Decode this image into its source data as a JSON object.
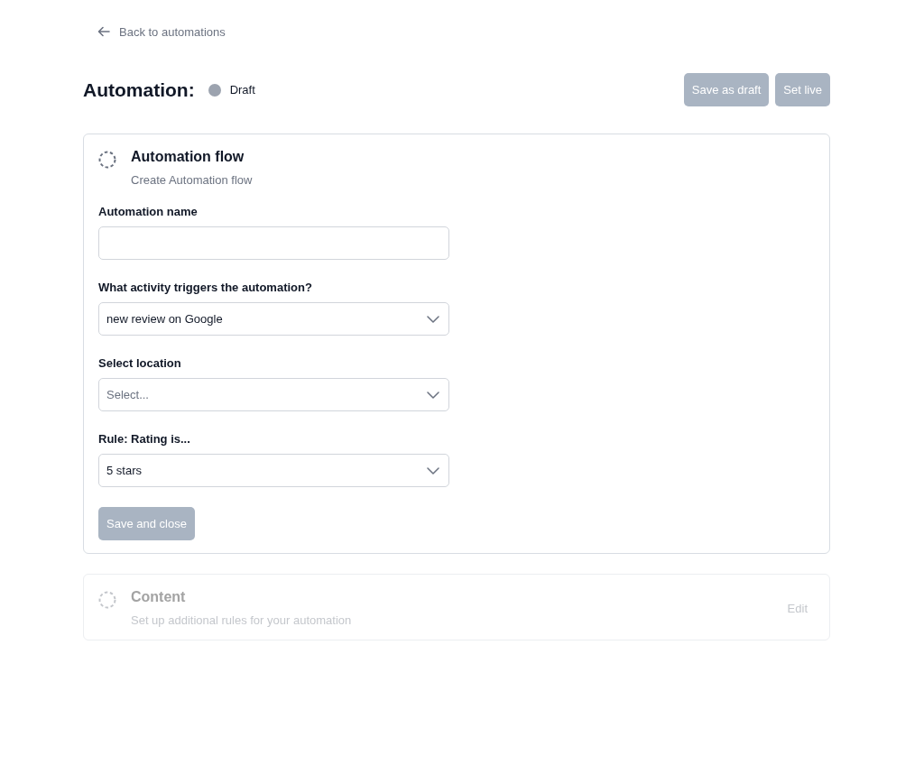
{
  "back_link": "Back to automations",
  "header": {
    "title": "Automation:",
    "status": {
      "label": "Draft",
      "color": "#9ca3af"
    },
    "buttons": [
      {
        "label": "Save as draft",
        "disabled": true
      },
      {
        "label": "Set live",
        "disabled": true
      }
    ]
  },
  "sections": [
    {
      "title": "Automation flow",
      "subtitle": "Create Automation flow",
      "active": true,
      "fields": [
        {
          "kind": "input",
          "label": "Automation name"
        },
        {
          "kind": "select",
          "label": "What activity triggers the automation?",
          "value": "new review on Google"
        },
        {
          "kind": "select",
          "label": "Select location",
          "placeholder": "Select..."
        },
        {
          "kind": "select",
          "label": "Rule: Rating is...",
          "value": "5 stars"
        }
      ],
      "submit": {
        "label": "Save and close",
        "disabled": true
      }
    },
    {
      "title": "Content",
      "subtitle": "Set up additional rules for your automation",
      "active": false,
      "edit_link": "Edit"
    }
  ]
}
